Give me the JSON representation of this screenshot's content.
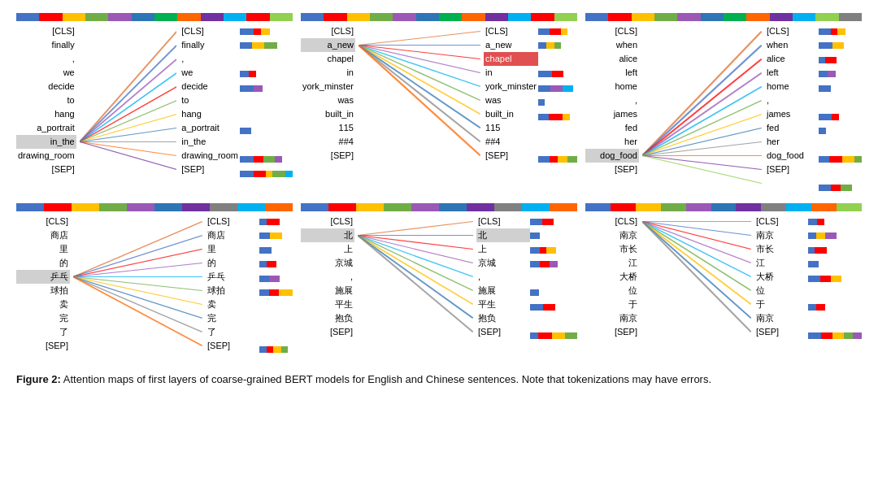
{
  "caption": {
    "label": "Figure 2:",
    "text": "  Attention maps of first layers of coarse-grained BERT models for English and Chinese sentences. Note that tokenizations may have errors."
  },
  "panels": [
    {
      "id": "p1",
      "colorBar": [
        "#4472C4",
        "#FF0000",
        "#FFC000",
        "#70AD47",
        "#9B59B6",
        "#2E75B6",
        "#00B050",
        "#FF6600",
        "#7030A0",
        "#00B0F0",
        "#FF0000",
        "#92D050"
      ],
      "leftTokens": [
        "[CLS]",
        "finally",
        ",",
        "we",
        "decide",
        "to",
        "hang",
        "a_portrait",
        "in_the",
        "drawing_room",
        "[SEP]"
      ],
      "rightTokens": [
        "[CLS]",
        "finally",
        ",",
        "we",
        "decide",
        "to",
        "hang",
        "a_portrait",
        "in_the",
        "drawing_room",
        "[SEP]"
      ],
      "highlightLeft": [
        8
      ],
      "highlightRight": [],
      "sourceIdx": 8,
      "lines": [
        {
          "to": 0,
          "color": "#E07030"
        },
        {
          "to": 1,
          "color": "#4472C4"
        },
        {
          "to": 2,
          "color": "#9B59B6"
        },
        {
          "to": 3,
          "color": "#00B0F0"
        },
        {
          "to": 4,
          "color": "#FF0000"
        },
        {
          "to": 5,
          "color": "#70AD47"
        },
        {
          "to": 6,
          "color": "#FFC000"
        },
        {
          "to": 7,
          "color": "#2E75B6"
        },
        {
          "to": 8,
          "color": "#888"
        },
        {
          "to": 9,
          "color": "#FF6600"
        },
        {
          "to": 10,
          "color": "#7030A0"
        }
      ],
      "rightBarColors": [
        [
          "#4472C4",
          "#FF0000",
          "#FFC000"
        ],
        [
          "#4472C4",
          "#FFC000",
          "#70AD47"
        ],
        [],
        [
          "#4472C4",
          "#FF0000"
        ],
        [
          "#4472C4",
          "#9B59B6"
        ],
        [],
        [],
        [
          "#4472C4"
        ],
        [],
        [
          "#4472C4",
          "#FF0000",
          "#70AD47",
          "#9B59B6"
        ],
        [
          "#4472C4",
          "#FF0000",
          "#FFC000",
          "#70AD47",
          "#00B0F0"
        ]
      ]
    },
    {
      "id": "p2",
      "colorBar": [
        "#4472C4",
        "#FF0000",
        "#FFC000",
        "#70AD47",
        "#9B59B6",
        "#2E75B6",
        "#00B050",
        "#FF6600",
        "#7030A0",
        "#00B0F0",
        "#FF0000",
        "#92D050"
      ],
      "leftTokens": [
        "[CLS]",
        "a_new",
        "chapel",
        "in",
        "york_minster",
        "was",
        "built_in",
        "115",
        "##4",
        "[SEP]"
      ],
      "rightTokens": [
        "[CLS]",
        "a_new",
        "chapel",
        "in",
        "york_minster",
        "was",
        "built_in",
        "115",
        "##4",
        "[SEP]"
      ],
      "highlightLeft": [
        1
      ],
      "highlightRight": [
        2
      ],
      "highlightRightRed": [
        2
      ],
      "sourceIdx": 1,
      "lines": [
        {
          "to": 0,
          "color": "#E07030"
        },
        {
          "to": 1,
          "color": "#4472C4"
        },
        {
          "to": 2,
          "color": "#FF0000"
        },
        {
          "to": 3,
          "color": "#9B59B6"
        },
        {
          "to": 4,
          "color": "#00B0F0"
        },
        {
          "to": 5,
          "color": "#70AD47"
        },
        {
          "to": 6,
          "color": "#FFC000"
        },
        {
          "to": 7,
          "color": "#2E75B6"
        },
        {
          "to": 8,
          "color": "#888"
        },
        {
          "to": 9,
          "color": "#FF6600"
        }
      ],
      "rightBarColors": [
        [
          "#4472C4",
          "#FF0000",
          "#FFC000"
        ],
        [
          "#4472C4",
          "#FFC000",
          "#70AD47"
        ],
        [],
        [
          "#4472C4",
          "#FF0000"
        ],
        [
          "#4472C4",
          "#9B59B6",
          "#00B0F0"
        ],
        [
          "#4472C4"
        ],
        [
          "#4472C4",
          "#FF0000",
          "#FFC000"
        ],
        [],
        [],
        [
          "#4472C4",
          "#FF0000",
          "#FFC000",
          "#70AD47"
        ]
      ]
    },
    {
      "id": "p3",
      "colorBar": [
        "#4472C4",
        "#FF0000",
        "#FFC000",
        "#70AD47",
        "#9B59B6",
        "#2E75B6",
        "#00B050",
        "#FF6600",
        "#7030A0",
        "#00B0F0",
        "#92D050",
        "#808080"
      ],
      "leftTokens": [
        "[CLS]",
        "when",
        "alice",
        "left",
        "home",
        ",",
        "james",
        "fed",
        "her",
        "dog_food",
        "",
        "[SEP]"
      ],
      "rightTokens": [
        "[CLS]",
        "when",
        "alice",
        "left",
        "home",
        ",",
        "james",
        "fed",
        "her",
        "dog_food",
        "",
        "[SEP]"
      ],
      "highlightLeft": [
        9
      ],
      "highlightRight": [],
      "sourceIdx": 9,
      "lines": [
        {
          "to": 0,
          "color": "#E07030"
        },
        {
          "to": 1,
          "color": "#4472C4"
        },
        {
          "to": 2,
          "color": "#FF0000"
        },
        {
          "to": 3,
          "color": "#9B59B6"
        },
        {
          "to": 4,
          "color": "#00B0F0"
        },
        {
          "to": 5,
          "color": "#70AD47"
        },
        {
          "to": 6,
          "color": "#FFC000"
        },
        {
          "to": 7,
          "color": "#2E75B6"
        },
        {
          "to": 8,
          "color": "#888"
        },
        {
          "to": 9,
          "color": "#FF6600"
        },
        {
          "to": 10,
          "color": "#7030A0"
        },
        {
          "to": 11,
          "color": "#92D050"
        }
      ],
      "rightBarColors": [
        [
          "#4472C4",
          "#FF0000",
          "#FFC000"
        ],
        [
          "#4472C4",
          "#FFC000"
        ],
        [
          "#4472C4",
          "#FF0000"
        ],
        [
          "#4472C4",
          "#9B59B6"
        ],
        [
          "#4472C4"
        ],
        [],
        [
          "#4472C4",
          "#FF0000"
        ],
        [
          "#4472C4"
        ],
        [],
        [
          "#4472C4",
          "#FF0000",
          "#FFC000",
          "#70AD47"
        ],
        [],
        [
          "#4472C4",
          "#FF0000",
          "#70AD47"
        ]
      ]
    },
    {
      "id": "p4",
      "colorBar": [
        "#4472C4",
        "#FF0000",
        "#FFC000",
        "#70AD47",
        "#9B59B6",
        "#2E75B6",
        "#7030A0",
        "#808080",
        "#00B0F0",
        "#FF6600"
      ],
      "leftTokens": [
        "[CLS]",
        "商店",
        "里",
        "的",
        "乒乓",
        "球拍",
        "卖",
        "完",
        "了",
        "[SEP]"
      ],
      "rightTokens": [
        "[CLS]",
        "商店",
        "里",
        "的",
        "乒乓",
        "球拍",
        "卖",
        "完",
        "了",
        "[SEP]"
      ],
      "highlightLeft": [
        4
      ],
      "highlightRight": [],
      "sourceIdx": 4,
      "lines": [
        {
          "to": 0,
          "color": "#E07030"
        },
        {
          "to": 1,
          "color": "#4472C4"
        },
        {
          "to": 2,
          "color": "#FF0000"
        },
        {
          "to": 3,
          "color": "#9B59B6"
        },
        {
          "to": 4,
          "color": "#00B0F0"
        },
        {
          "to": 5,
          "color": "#70AD47"
        },
        {
          "to": 6,
          "color": "#FFC000"
        },
        {
          "to": 7,
          "color": "#2E75B6"
        },
        {
          "to": 8,
          "color": "#888"
        },
        {
          "to": 9,
          "color": "#FF6600"
        }
      ],
      "rightBarColors": [
        [
          "#4472C4",
          "#FF0000"
        ],
        [
          "#4472C4",
          "#FFC000"
        ],
        [
          "#4472C4"
        ],
        [
          "#4472C4",
          "#FF0000"
        ],
        [
          "#4472C4",
          "#9B59B6"
        ],
        [
          "#4472C4",
          "#FF0000",
          "#FFC000"
        ],
        [],
        [],
        [],
        [
          "#4472C4",
          "#FF0000",
          "#FFC000",
          "#70AD47"
        ]
      ]
    },
    {
      "id": "p5",
      "colorBar": [
        "#4472C4",
        "#FF0000",
        "#FFC000",
        "#70AD47",
        "#9B59B6",
        "#2E75B6",
        "#7030A0",
        "#808080",
        "#00B0F0",
        "#FF6600"
      ],
      "leftTokens": [
        "[CLS]",
        "北",
        "上",
        "京城",
        ",",
        "施展",
        "平生",
        "抱负",
        "[SEP]"
      ],
      "rightTokens": [
        "[CLS]",
        "北",
        "上",
        "京城",
        ",",
        "施展",
        "平生",
        "抱负",
        "[SEP]"
      ],
      "highlightLeft": [
        1
      ],
      "highlightRight": [
        1
      ],
      "sourceIdx": 1,
      "lines": [
        {
          "to": 0,
          "color": "#E07030"
        },
        {
          "to": 1,
          "color": "#4472C4"
        },
        {
          "to": 2,
          "color": "#FF0000"
        },
        {
          "to": 3,
          "color": "#9B59B6"
        },
        {
          "to": 4,
          "color": "#00B0F0"
        },
        {
          "to": 5,
          "color": "#70AD47"
        },
        {
          "to": 6,
          "color": "#FFC000"
        },
        {
          "to": 7,
          "color": "#2E75B6"
        },
        {
          "to": 8,
          "color": "#888"
        }
      ],
      "rightBarColors": [
        [
          "#4472C4",
          "#FF0000"
        ],
        [
          "#4472C4"
        ],
        [
          "#4472C4",
          "#FF0000",
          "#FFC000"
        ],
        [
          "#4472C4",
          "#FF0000",
          "#9B59B6"
        ],
        [],
        [
          "#4472C4"
        ],
        [
          "#4472C4",
          "#FF0000"
        ],
        [],
        [
          "#4472C4",
          "#FF0000",
          "#FFC000",
          "#70AD47"
        ]
      ]
    },
    {
      "id": "p6",
      "colorBar": [
        "#4472C4",
        "#FF0000",
        "#FFC000",
        "#70AD47",
        "#9B59B6",
        "#2E75B6",
        "#7030A0",
        "#808080",
        "#00B0F0",
        "#FF6600",
        "#92D050"
      ],
      "leftTokens": [
        "[CLS]",
        "南京",
        "市长",
        "江",
        "大桥",
        "位",
        "于",
        "南京",
        "[SEP]"
      ],
      "rightTokens": [
        "[CLS]",
        "南京",
        "市长",
        "江",
        "大桥",
        "位",
        "于",
        "南京",
        "[SEP]"
      ],
      "highlightLeft": [],
      "highlightRight": [],
      "sourceIdx": 0,
      "lines": [
        {
          "to": 0,
          "color": "#E07030"
        },
        {
          "to": 1,
          "color": "#4472C4"
        },
        {
          "to": 2,
          "color": "#FF0000"
        },
        {
          "to": 3,
          "color": "#9B59B6"
        },
        {
          "to": 4,
          "color": "#00B0F0"
        },
        {
          "to": 5,
          "color": "#70AD47"
        },
        {
          "to": 6,
          "color": "#FFC000"
        },
        {
          "to": 7,
          "color": "#2E75B6"
        },
        {
          "to": 8,
          "color": "#888"
        }
      ],
      "rightBarColors": [
        [
          "#4472C4",
          "#FF0000"
        ],
        [
          "#4472C4",
          "#FFC000",
          "#9B59B6"
        ],
        [
          "#4472C4",
          "#FF0000"
        ],
        [
          "#4472C4"
        ],
        [
          "#4472C4",
          "#FF0000",
          "#FFC000"
        ],
        [],
        [
          "#4472C4",
          "#FF0000"
        ],
        [],
        [
          "#4472C4",
          "#FF0000",
          "#FFC000",
          "#70AD47",
          "#9B59B6"
        ]
      ]
    }
  ]
}
